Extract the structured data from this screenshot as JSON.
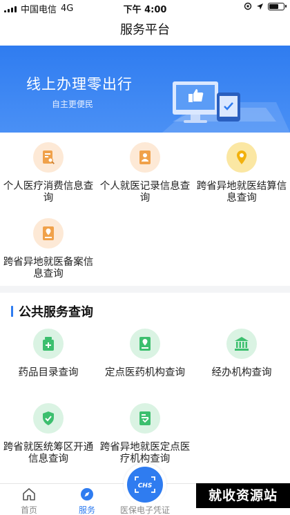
{
  "status_bar": {
    "carrier": "中国电信",
    "network": "4G",
    "time": "下午 4:00",
    "battery_level": 0.7
  },
  "nav": {
    "title": "服务平台"
  },
  "banner": {
    "title": "线上办理零出行",
    "subtitle": "自主更便民"
  },
  "personal_services": [
    {
      "label": "个人医疗消费信息查询",
      "icon": "receipt-search-icon"
    },
    {
      "label": "个人就医记录信息查询",
      "icon": "medical-record-icon"
    },
    {
      "label": "跨省异地就医结算信息查询",
      "icon": "location-pin-icon"
    },
    {
      "label": "跨省异地就医备案信息查询",
      "icon": "filing-location-icon"
    }
  ],
  "public_section": {
    "title": "公共服务查询"
  },
  "public_services": [
    {
      "label": "药品目录查询",
      "icon": "medicine-box-icon"
    },
    {
      "label": "定点医药机构查询",
      "icon": "pharmacy-institution-icon"
    },
    {
      "label": "经办机构查询",
      "icon": "building-icon"
    },
    {
      "label": "跨省就医统筹区开通信息查询",
      "icon": "coverage-area-icon"
    },
    {
      "label": "跨省异地就医定点医疗机构查询",
      "icon": "hospital-document-icon"
    }
  ],
  "tabbar": {
    "home_label": "首页",
    "service_label": "服务",
    "center_label": "医保电子凭证",
    "center_badge": "CHS"
  },
  "watermark": "就收资源站",
  "colors": {
    "accent": "#2f7cf0",
    "orange_icon": "#f0a14a",
    "green_icon": "#3cbf6e"
  }
}
